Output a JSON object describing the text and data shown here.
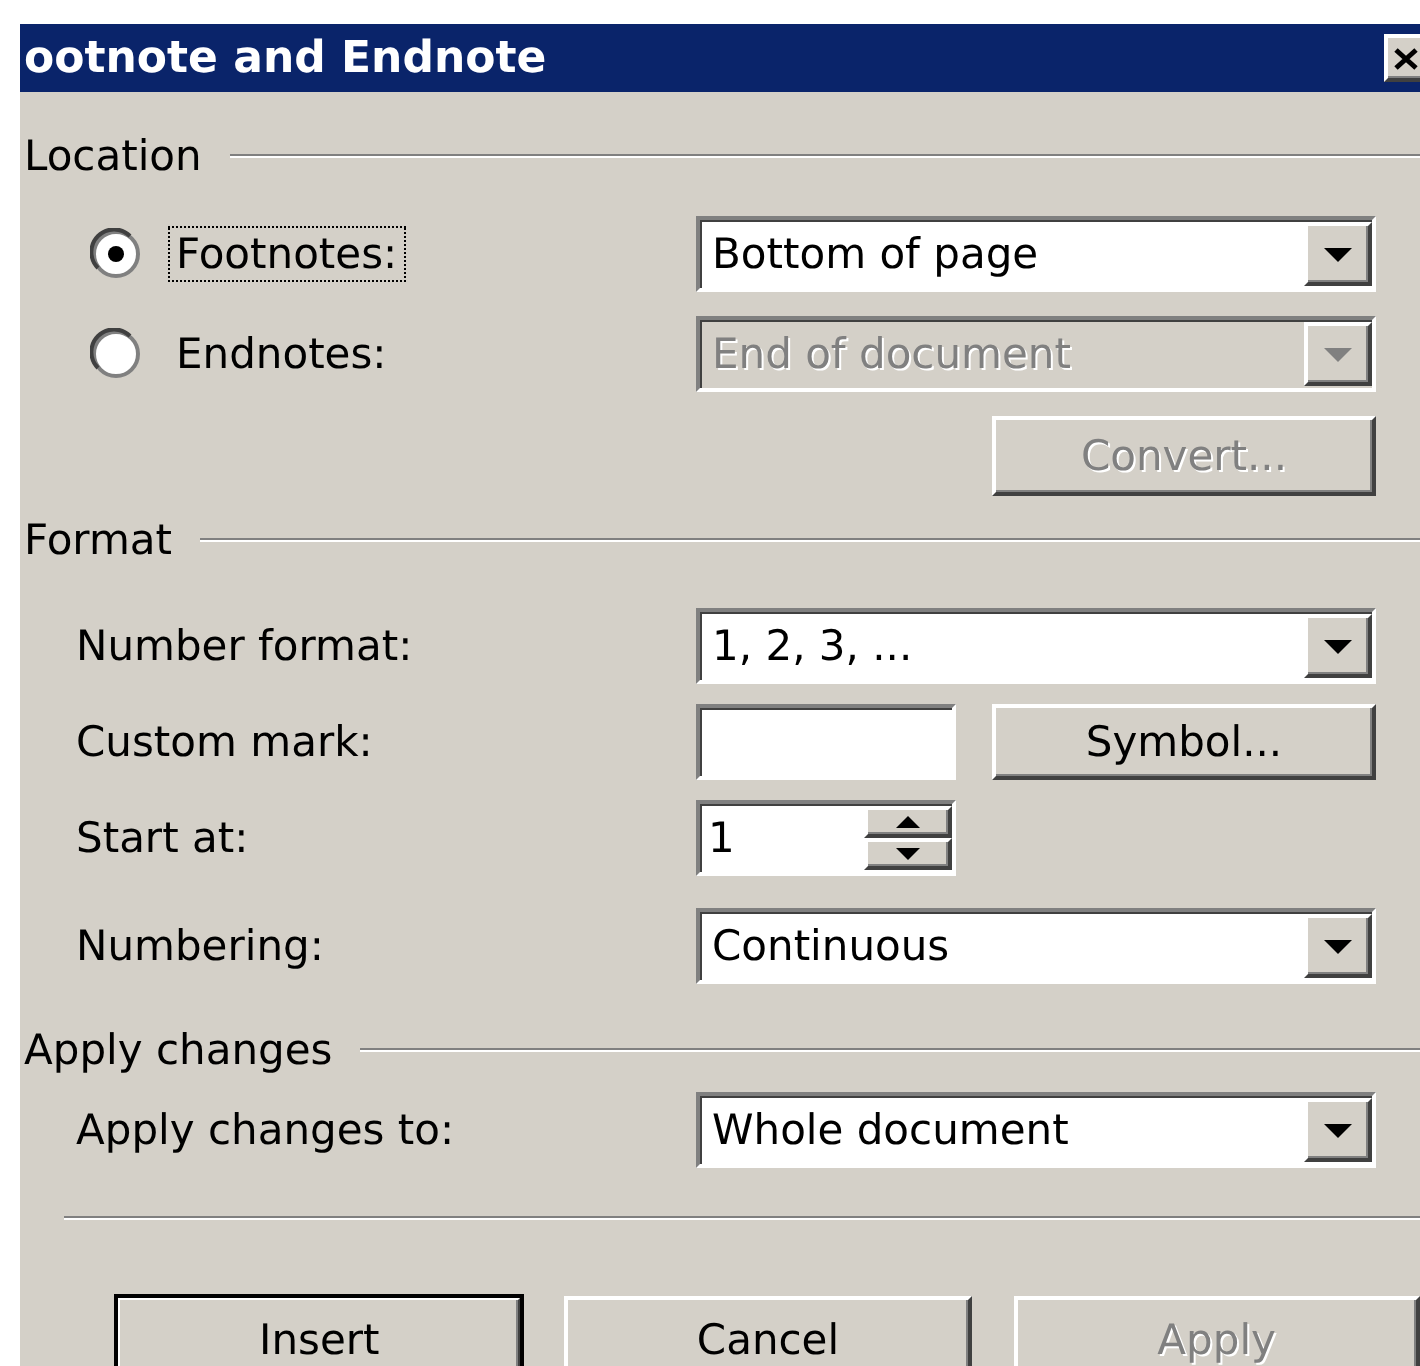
{
  "window": {
    "title": "ootnote and Endnote"
  },
  "location": {
    "label": "Location",
    "options": [
      {
        "label": "Footnotes:",
        "selected": true,
        "focused": true,
        "dropdown": {
          "value": "Bottom of page",
          "disabled": false
        }
      },
      {
        "label": "Endnotes:",
        "selected": false,
        "focused": false,
        "dropdown": {
          "value": "End of document",
          "disabled": true
        }
      }
    ],
    "convert_button": {
      "label": "Convert...",
      "disabled": true
    }
  },
  "format": {
    "label": "Format",
    "fields": [
      {
        "kind": "dropdown",
        "label": "Number format:",
        "value": "1, 2, 3, ..."
      },
      {
        "kind": "text",
        "label": "Custom mark:",
        "button": "Symbol..."
      },
      {
        "kind": "spinner",
        "label": "Start at:",
        "value": "1"
      },
      {
        "kind": "dropdown",
        "label": "Numbering:",
        "value": "Continuous"
      }
    ]
  },
  "apply_changes": {
    "label": "Apply changes",
    "fields": [
      {
        "kind": "dropdown",
        "label": "Apply changes to:",
        "value": "Whole document"
      }
    ]
  },
  "buttons": [
    {
      "label": "Insert",
      "default": true,
      "disabled": false
    },
    {
      "label": "Cancel",
      "default": false,
      "disabled": false
    },
    {
      "label": "Apply",
      "default": false,
      "disabled": true
    }
  ]
}
